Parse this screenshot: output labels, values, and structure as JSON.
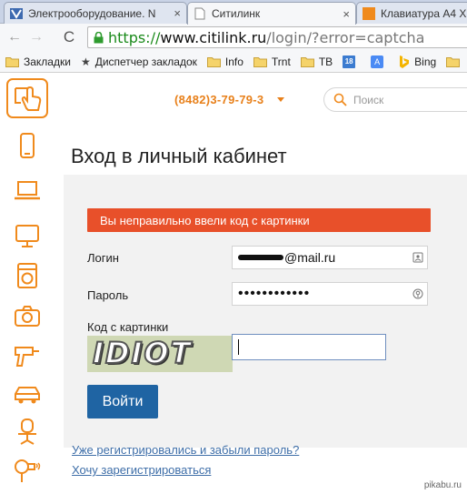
{
  "browser": {
    "tabs": [
      {
        "title": "Электрооборудование. N",
        "close": "×"
      },
      {
        "title": "Ситилинк",
        "close": "×"
      },
      {
        "title": "Клавиатура A4 X",
        "close": ""
      }
    ],
    "nav": {
      "back": "←",
      "forward": "→",
      "reload": "C"
    },
    "url": {
      "scheme": "https://",
      "host": "www.citilink.ru",
      "path": "/login/?error=captcha"
    },
    "bookmarks": [
      {
        "label": "Закладки",
        "icon": "folder-icon"
      },
      {
        "label": "Диспетчер закладок",
        "icon": "star-icon"
      },
      {
        "label": "Info",
        "icon": "folder-icon"
      },
      {
        "label": "Trnt",
        "icon": "folder-icon"
      },
      {
        "label": "ТВ",
        "icon": "folder-icon"
      },
      {
        "label": "",
        "icon": "calendar-icon",
        "badge": "18"
      },
      {
        "label": "",
        "icon": "translate-icon",
        "badge": "A"
      },
      {
        "label": "Bing",
        "icon": "bing-icon"
      },
      {
        "label": "",
        "icon": "folder-icon"
      }
    ]
  },
  "site": {
    "phone": "(8482)3-79-79-3",
    "search_placeholder": "Поиск",
    "title": "Вход в личный кабинет",
    "error": "Вы неправильно ввели код с картинки",
    "login_label": "Логин",
    "login_value": "@mail.ru",
    "password_label": "Пароль",
    "password_value": "••••••••••••",
    "captcha_label": "Код с картинки",
    "captcha_text": "IDIOT",
    "submit": "Войти",
    "forgot_link": "Уже регистрировались и забыли пароль?",
    "register_link": "Хочу зарегистрироваться",
    "sidebar_icons": [
      "hand-pointer-icon",
      "smartphone-icon",
      "laptop-icon",
      "monitor-icon",
      "washing-machine-icon",
      "camera-icon",
      "drill-icon",
      "car-icon",
      "office-chair-icon",
      "hair-dryer-icon"
    ]
  },
  "colors": {
    "accent": "#f08a1c",
    "error": "#e8502a",
    "button": "#1f64a3",
    "link": "#3e6ea8"
  },
  "watermark": "pikabu.ru"
}
